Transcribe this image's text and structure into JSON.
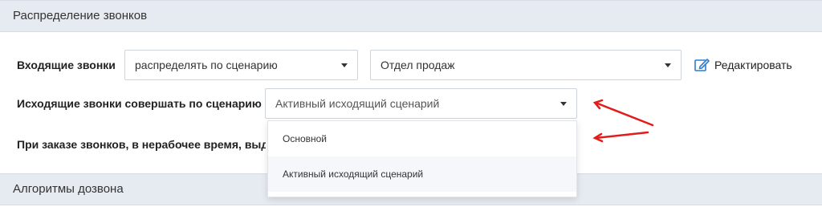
{
  "sections": {
    "distribution_title": "Распределение звонков",
    "algorithms_title": "Алгоритмы дозвона"
  },
  "incoming": {
    "label": "Входящие звонки",
    "mode_value": "распределять по сценарию",
    "department_value": "Отдел продаж",
    "edit_label": "Редактировать"
  },
  "outgoing": {
    "label": "Исходящие звонки совершать по сценарию",
    "scenario_value": "Активный исходящий сценарий"
  },
  "after_hours": {
    "label": "При заказе звонков, в нерабочее время, выде"
  },
  "scenario_options": [
    "Основной",
    "Активный исходящий сценарий"
  ],
  "colors": {
    "section_bg": "#e6ebf1",
    "edit_icon": "#2a7fd4",
    "annotation_arrow": "#e31b1b"
  }
}
